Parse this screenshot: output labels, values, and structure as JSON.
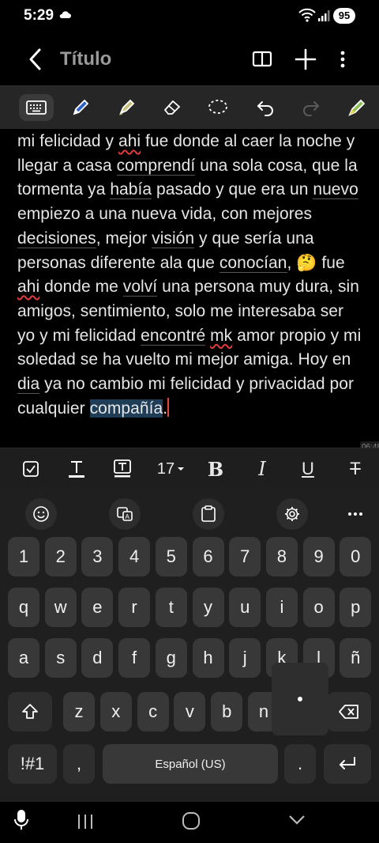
{
  "status": {
    "time": "5:29",
    "battery": "95"
  },
  "titlebar": {
    "title": "Título"
  },
  "note": {
    "segments": [
      {
        "t": "mi felicidad y "
      },
      {
        "t": "ahi",
        "c": "sq"
      },
      {
        "t": " fue donde al caer la noche y llegar a casa "
      },
      {
        "t": "comprendí",
        "c": "gr"
      },
      {
        "t": " una sola cosa, que la tormenta ya "
      },
      {
        "t": "había",
        "c": "gr"
      },
      {
        "t": " pasado y que era un "
      },
      {
        "t": "nuevo",
        "c": "gr"
      },
      {
        "t": " empiezo a una nueva vida, con mejores "
      },
      {
        "t": "decisiones",
        "c": "gr"
      },
      {
        "t": ", mejor "
      },
      {
        "t": "visión",
        "c": "gr"
      },
      {
        "t": " y que sería una personas diferente ala que "
      },
      {
        "t": "conocían",
        "c": "gr"
      },
      {
        "t": ", 🤔  fue "
      },
      {
        "t": "ahi",
        "c": "sq"
      },
      {
        "t": " donde me "
      },
      {
        "t": "volví",
        "c": "gr"
      },
      {
        "t": " una persona muy dura, sin amigos, sentimiento, solo me interesaba ser yo y mi felicidad "
      },
      {
        "t": "encontré",
        "c": "gr"
      },
      {
        "t": " "
      },
      {
        "t": "mk",
        "c": "sq"
      },
      {
        "t": " amor propio y mi soledad se ha vuelto mi mejor amiga. Hoy en "
      },
      {
        "t": "dia",
        "c": "gr"
      },
      {
        "t": " ya no cambio mi felicidad y privacidad por cualquier "
      },
      {
        "t": "compañía",
        "c": "sel"
      },
      {
        "t": "."
      }
    ],
    "clip_hint": "06:48"
  },
  "format_toolbar": {
    "font_size": "17",
    "bold": "B",
    "italic": "I",
    "underline": "U",
    "strike": "T"
  },
  "keyboard": {
    "row_numbers": [
      "1",
      "2",
      "3",
      "4",
      "5",
      "6",
      "7",
      "8",
      "9",
      "0"
    ],
    "row1": [
      "q",
      "w",
      "e",
      "r",
      "t",
      "y",
      "u",
      "i",
      "o",
      "p"
    ],
    "row2": [
      "a",
      "s",
      "d",
      "f",
      "g",
      "h",
      "j",
      "k",
      "l",
      "ñ"
    ],
    "row3": [
      "z",
      "x",
      "c",
      "v",
      "b",
      "n"
    ],
    "symbols_key": "!#1",
    "comma_key": ",",
    "space_label": "Español (US)",
    "period_key": "."
  },
  "icons": {
    "back": "back-arrow-icon",
    "book": "reading-mode-icon",
    "add": "plus-icon",
    "more": "more-vert-icon",
    "keyboard": "keyboard-icon",
    "pen": "pen-icon",
    "highlighter": "highlighter-icon",
    "eraser": "eraser-icon",
    "lasso": "lasso-select-icon",
    "undo": "undo-icon",
    "redo": "redo-icon",
    "pen_settings": "pen-settings-icon"
  },
  "colors": {
    "accent_red": "#e24646",
    "selection": "#1f3d57",
    "title_gray": "#9a9a9a"
  }
}
